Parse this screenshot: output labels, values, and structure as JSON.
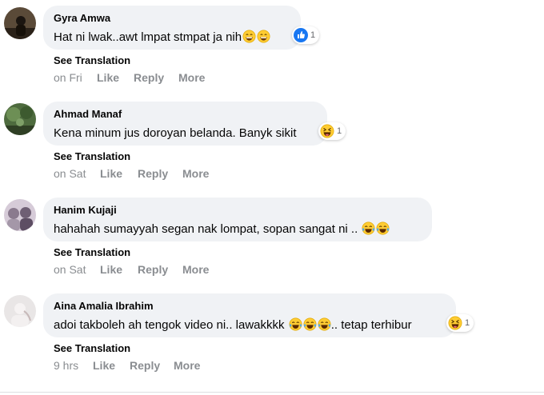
{
  "comments": [
    {
      "author": "Gyra Amwa",
      "text": "Hat ni lwak..awt lmpat stmpat ja nih",
      "emojis": [
        "grin-face-icon",
        "grin-face-icon"
      ],
      "reaction_icon": "like-icon",
      "reaction_count": "1",
      "see_translation": "See Translation",
      "time": "on Fri",
      "like": "Like",
      "reply": "Reply",
      "more": "More"
    },
    {
      "author": "Ahmad Manaf",
      "text": "Kena minum jus doroyan belanda. Banyk sikit",
      "emojis": [],
      "reaction_icon": "haha-icon",
      "reaction_count": "1",
      "see_translation": "See Translation",
      "time": "on Sat",
      "like": "Like",
      "reply": "Reply",
      "more": "More"
    },
    {
      "author": "Hanim Kujaji",
      "text": "hahahah sumayyah segan nak lompat, sopan sangat ni ..",
      "emojis": [
        "tears-of-joy-icon",
        "tears-of-joy-icon"
      ],
      "reaction_icon": "",
      "reaction_count": "",
      "see_translation": "See Translation",
      "time": "on Sat",
      "like": "Like",
      "reply": "Reply",
      "more": "More"
    },
    {
      "author": "Aina Amalia Ibrahim",
      "text": "adoi takboleh ah tengok video ni.. lawakkkk",
      "emojis": [
        "tears-of-joy-icon",
        "tears-of-joy-icon",
        "tears-of-joy-icon"
      ],
      "text_after": ".. tetap terhibur",
      "reaction_icon": "haha-icon",
      "reaction_count": "1",
      "see_translation": "See Translation",
      "time": "9 hrs",
      "like": "Like",
      "reply": "Reply",
      "more": "More"
    }
  ],
  "colors": {
    "bubble": "#f0f2f5",
    "meta_text": "#8a8d91",
    "like_blue": "#1877f2",
    "emoji_yellow": "#ffcc33"
  }
}
